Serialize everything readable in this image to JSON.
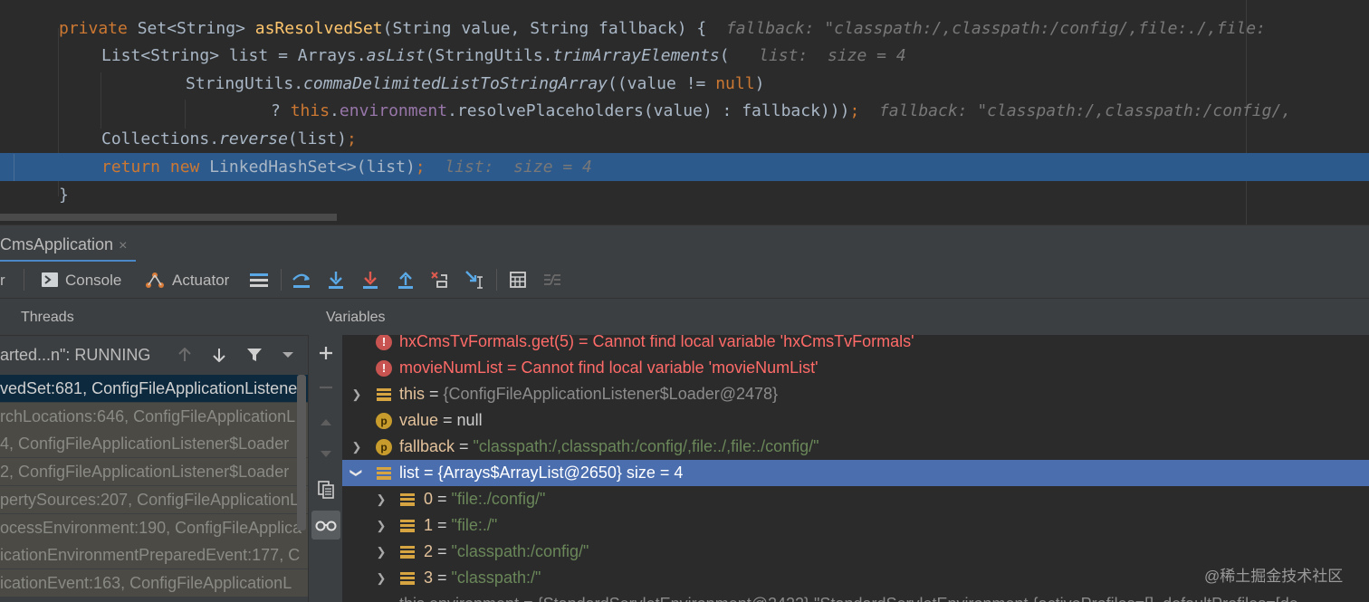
{
  "editor": {
    "l1": {
      "kw": "private ",
      "t1": "Set<String> ",
      "fn": "asResolvedSet",
      "t2": "(String value, String fallback) {",
      "hint": "fallback: \"classpath:/,classpath:/config/,file:./,file:"
    },
    "l2": {
      "t1": "List<String> list = Arrays.",
      "it1": "asList",
      "t2": "(StringUtils.",
      "it2": "trimArrayElements",
      "t3": "(",
      "hint": "list:  size = 4"
    },
    "l3": {
      "t1": "StringUtils.",
      "it1": "commaDelimitedListToStringArray",
      "t2": "((value != ",
      "kw": "null",
      "t3": ")"
    },
    "l4": {
      "t1": "? ",
      "kw1": "this",
      "t2": ".",
      "fld": "environment",
      "t3": ".resolvePlaceholders(value) : fallback)))",
      "semi": ";",
      "hint": "fallback: \"classpath:/,classpath:/config/,"
    },
    "l5": {
      "t1": "Collections.",
      "it1": "reverse",
      "t2": "(list)",
      "semi": ";"
    },
    "l6": {
      "kw1": "return ",
      "kw2": "new ",
      "t1": "LinkedHashSet<>(list)",
      "semi": ";",
      "hint": "list:  size = 4"
    },
    "l7": {
      "t1": "}"
    }
  },
  "run_tab": {
    "label": "CmsApplication",
    "close": "×"
  },
  "toolbar": {
    "debugger_label": "r",
    "console_label": "Console",
    "actuator_label": "Actuator"
  },
  "frames": {
    "header": "Threads",
    "thread": "arted...n\": RUNNING",
    "items": [
      "vedSet:681, ConfigFileApplicationListene",
      "rchLocations:646, ConfigFileApplicationL",
      "4, ConfigFileApplicationListener$Loader",
      "2, ConfigFileApplicationListener$Loader",
      "pertySources:207, ConfigFileApplicationL",
      "ocessEnvironment:190, ConfigFileApplica",
      "icationEnvironmentPreparedEvent:177, C",
      "icationEvent:163, ConfigFileApplicationL"
    ]
  },
  "variables": {
    "header": "Variables",
    "v_hx": {
      "name": "hxCmsTvFormals.get(5)",
      "eq": " = ",
      "msg": "Cannot find local variable 'hxCmsTvFormals'"
    },
    "v_movie": {
      "name": "movieNumList",
      "eq": " = ",
      "msg": "Cannot find local variable 'movieNumList'"
    },
    "v_this": {
      "name": "this",
      "eq": " = ",
      "value": "{ConfigFileApplicationListener$Loader@2478}"
    },
    "v_value": {
      "name": "value",
      "eq": " = ",
      "value": "null",
      "icon": "p"
    },
    "v_fallback": {
      "name": "fallback",
      "eq": " = ",
      "value": "\"classpath:/,classpath:/config/,file:./,file:./config/\"",
      "icon": "p"
    },
    "v_list": {
      "name": "list",
      "eq": " = ",
      "value": "{Arrays$ArrayList@2650}",
      "size": "  size = 4"
    },
    "v_0": {
      "name": "0",
      "eq": " = ",
      "value": "\"file:./config/\""
    },
    "v_1": {
      "name": "1",
      "eq": " = ",
      "value": "\"file:./\""
    },
    "v_2": {
      "name": "2",
      "eq": " = ",
      "value": "\"classpath:/config/\""
    },
    "v_3": {
      "name": "3",
      "eq": " = ",
      "value": "\"classpath:/\""
    },
    "v_env": {
      "value": "this.environment = {StandardServletEnvironment@2422} \"StandardServletEnvironment {activeProfiles=[], defaultProfiles=[de"
    }
  },
  "watermark": "@稀土掘金技术社区",
  "colors": {
    "accent": "#4a88c7",
    "selection": "#4b6eaf",
    "current_line": "#2d5a8c",
    "error": "#ff6b68",
    "string": "#6a8759",
    "keyword": "#cc7832"
  }
}
